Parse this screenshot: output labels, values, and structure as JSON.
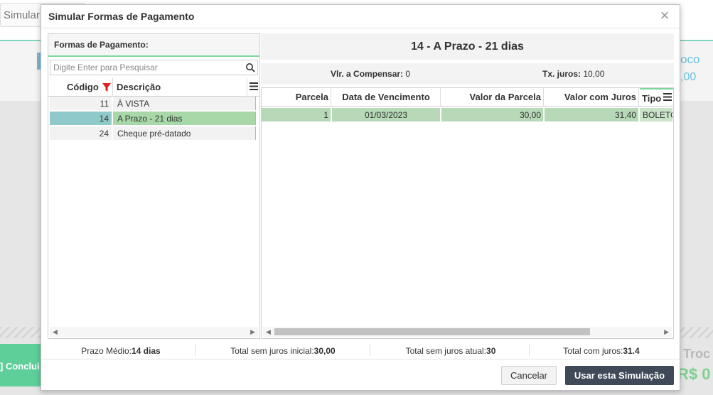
{
  "background": {
    "tab_label": "Simular",
    "right_text_1": "oco",
    "right_text_2": ",00",
    "conclude_label": "] Conclui",
    "troco_label": "Troc",
    "rs_label": "R$ 0"
  },
  "modal": {
    "title": "Simular Formas de Pagamento",
    "close_glyph": "×"
  },
  "left": {
    "header": "Formas de Pagamento:",
    "search_placeholder": "Digite Enter para Pesquisar",
    "columns": {
      "codigo": "Código",
      "descricao": "Descrição"
    },
    "rows": [
      {
        "codigo": "11",
        "descricao": "À VISTA",
        "selected": false
      },
      {
        "codigo": "14",
        "descricao": "A Prazo - 21 dias",
        "selected": true
      },
      {
        "codigo": "24",
        "descricao": "Cheque pré-datado",
        "selected": false
      }
    ]
  },
  "right": {
    "title": "14 - A Prazo - 21 dias",
    "vlr_compensar_label": "Vlr. a Compensar:",
    "vlr_compensar_value": "0",
    "tx_juros_label": "Tx. juros:",
    "tx_juros_value": "10,00",
    "columns": {
      "parcela": "Parcela",
      "data": "Data de Vencimento",
      "valor": "Valor da Parcela",
      "juros": "Valor com Juros",
      "tipo": "Tipo"
    },
    "rows": [
      {
        "parcela": "1",
        "data": "01/03/2023",
        "valor": "30,00",
        "juros": "31,40",
        "tipo": "BOLETO"
      }
    ]
  },
  "summary": {
    "prazo_label": "Prazo Médio:",
    "prazo_value": "14 dias",
    "sem_juros_inicial_label": "Total sem juros inicial:",
    "sem_juros_inicial_value": "30,00",
    "sem_juros_atual_label": "Total sem juros atual:",
    "sem_juros_atual_value": "30",
    "com_juros_label": "Total com juros:",
    "com_juros_value": "31.4"
  },
  "buttons": {
    "cancel": "Cancelar",
    "use": "Usar esta Simulação"
  },
  "colors": {
    "accent_green": "#7fd69a",
    "selected_row": "#a8d7a8",
    "primary_button": "#3f4957"
  }
}
